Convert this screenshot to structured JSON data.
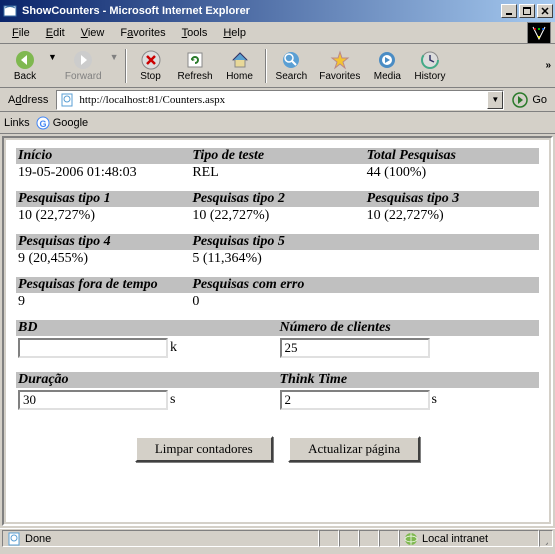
{
  "window": {
    "title": "ShowCounters - Microsoft Internet Explorer"
  },
  "menu": {
    "file": "File",
    "edit": "Edit",
    "view": "View",
    "favorites": "Favorites",
    "tools": "Tools",
    "help": "Help"
  },
  "toolbar": {
    "back": "Back",
    "forward": "Forward",
    "stop": "Stop",
    "refresh": "Refresh",
    "home": "Home",
    "search": "Search",
    "favorites": "Favorites",
    "media": "Media",
    "history": "History"
  },
  "address": {
    "label": "Address",
    "url": "http://localhost:81/Counters.aspx",
    "go": "Go"
  },
  "links": {
    "label": "Links",
    "google": "Google"
  },
  "grid": {
    "r1": {
      "h1": "Início",
      "v1": "19-05-2006 01:48:03",
      "h2": "Tipo de teste",
      "v2": "REL",
      "h3": "Total Pesquisas",
      "v3": "44 (100%)"
    },
    "r2": {
      "h1": "Pesquisas tipo 1",
      "v1": "10 (22,727%)",
      "h2": "Pesquisas tipo 2",
      "v2": "10 (22,727%)",
      "h3": "Pesquisas tipo 3",
      "v3": "10 (22,727%)"
    },
    "r3": {
      "h1": "Pesquisas tipo 4",
      "v1": "9 (20,455%)",
      "h2": "Pesquisas tipo 5",
      "v2": "5 (11,364%)"
    },
    "r4": {
      "h1": "Pesquisas fora de tempo",
      "v1": "9",
      "h2": "Pesquisas com erro",
      "v2": "0"
    }
  },
  "form": {
    "bd": {
      "label": "BD",
      "value": "",
      "unit": "k"
    },
    "clients": {
      "label": "Número de clientes",
      "value": "25"
    },
    "duration": {
      "label": "Duração",
      "value": "30",
      "unit": "s"
    },
    "think": {
      "label": "Think Time",
      "value": "2",
      "unit": "s"
    }
  },
  "buttons": {
    "clear": "Limpar contadores",
    "refresh": "Actualizar página"
  },
  "status": {
    "text": "Done",
    "zone": "Local intranet"
  }
}
